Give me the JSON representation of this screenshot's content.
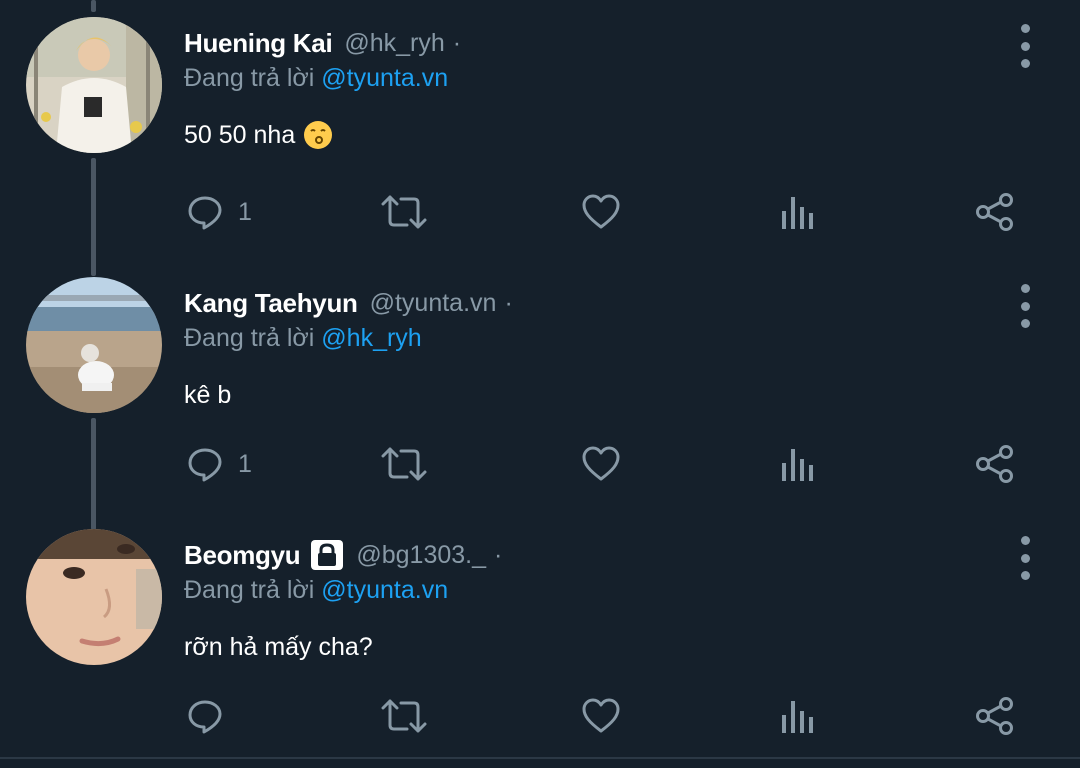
{
  "reply_prefix": "Đang trả lời",
  "tweets": [
    {
      "name": "Huening Kai",
      "handle": "@hk_ryh",
      "separator": "·",
      "reply_to": "@tyunta.vn",
      "text": "50 50 nha",
      "emoji": "kissing-face-icon",
      "reply_count": "1",
      "locked": false
    },
    {
      "name": "Kang Taehyun",
      "handle": "@tyunta.vn",
      "separator": "·",
      "reply_to": "@hk_ryh",
      "text": "kê b",
      "reply_count": "1",
      "locked": false
    },
    {
      "name": "Beomgyu",
      "handle": "@bg1303._",
      "separator": "·",
      "reply_to": "@tyunta.vn",
      "text": "rỡn hả mấy cha?",
      "reply_count": "",
      "locked": true
    }
  ],
  "colors": {
    "background": "#15202b",
    "secondary_text": "#8899a6",
    "link": "#1da1f2",
    "thread_line": "#4a5663"
  }
}
